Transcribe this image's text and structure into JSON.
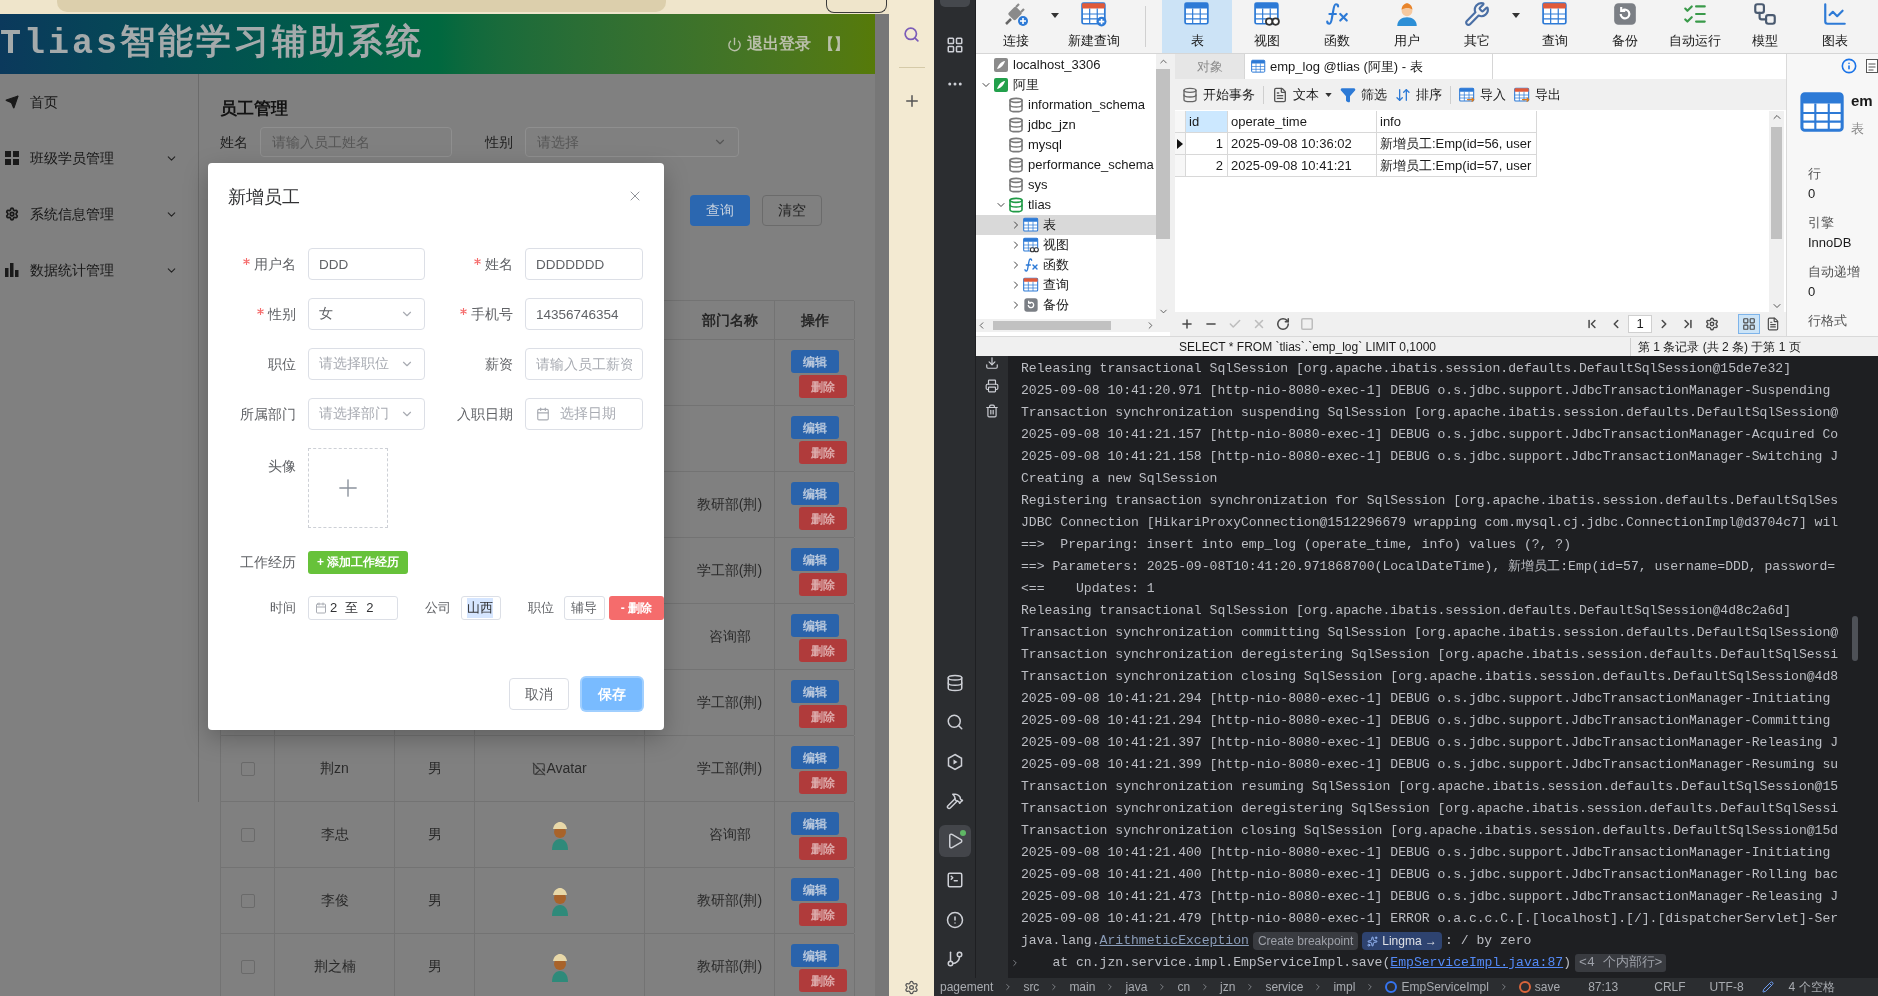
{
  "browser": {
    "header": {
      "title": "Tlias智能学习辅助系统",
      "logout": "退出登录",
      "header_button": "【】"
    },
    "sidebar": {
      "items": [
        {
          "label": "首页",
          "kind": "link"
        },
        {
          "label": "班级学员管理",
          "kind": "submenu"
        },
        {
          "label": "系统信息管理",
          "kind": "submenu"
        },
        {
          "label": "数据统计管理",
          "kind": "submenu"
        }
      ]
    },
    "page": {
      "title": "员工管理",
      "filters": [
        {
          "label": "姓名",
          "kind": "input",
          "placeholder": "请输入员工姓名"
        },
        {
          "label": "性别",
          "kind": "select",
          "placeholder": "请选择"
        }
      ],
      "buttons": [
        {
          "label": "查询",
          "kind": "primary"
        },
        {
          "label": "清空",
          "kind": "default"
        }
      ],
      "table": {
        "columns": [
          {
            "label": "部门名称"
          },
          {
            "label": "操作"
          }
        ],
        "rows": [
          {
            "actions": [
              {
                "label": "编辑",
                "kind": "edit"
              },
              {
                "label": "删除",
                "kind": "delete"
              }
            ]
          },
          {
            "actions": [
              {
                "label": "编辑",
                "kind": "edit"
              },
              {
                "label": "删除",
                "kind": "delete"
              }
            ]
          },
          {
            "department": "教研部(荆)",
            "actions": [
              {
                "label": "编辑",
                "kind": "edit"
              },
              {
                "label": "删除",
                "kind": "delete"
              }
            ]
          },
          {
            "department": "学工部(荆)",
            "actions": [
              {
                "label": "编辑",
                "kind": "edit"
              },
              {
                "label": "删除",
                "kind": "delete"
              }
            ]
          },
          {
            "department": "咨询部",
            "actions": [
              {
                "label": "编辑",
                "kind": "edit"
              },
              {
                "label": "删除",
                "kind": "delete"
              }
            ]
          },
          {
            "department": "学工部(荆)",
            "actions": [
              {
                "label": "编辑",
                "kind": "edit"
              },
              {
                "label": "删除",
                "kind": "delete"
              }
            ]
          },
          {
            "checked": false,
            "name": "荆zn",
            "gender": "男",
            "avatar": {
              "kind": "broken",
              "alt": "Avatar"
            },
            "department": "学工部(荆)",
            "actions": [
              {
                "label": "编辑",
                "kind": "edit"
              },
              {
                "label": "删除",
                "kind": "delete"
              }
            ]
          },
          {
            "checked": false,
            "name": "李忠",
            "gender": "男",
            "avatar": {
              "kind": "picture"
            },
            "department": "咨询部",
            "actions": [
              {
                "label": "编辑",
                "kind": "edit"
              },
              {
                "label": "删除",
                "kind": "delete"
              }
            ]
          },
          {
            "checked": false,
            "name": "李俊",
            "gender": "男",
            "avatar": {
              "kind": "picture"
            },
            "department": "教研部(荆)",
            "actions": [
              {
                "label": "编辑",
                "kind": "edit"
              },
              {
                "label": "删除",
                "kind": "delete"
              }
            ]
          },
          {
            "checked": false,
            "name": "荆之楠",
            "gender": "男",
            "avatar": {
              "kind": "picture"
            },
            "department": "教研部(荆)",
            "actions": [
              {
                "label": "编辑",
                "kind": "edit"
              },
              {
                "label": "删除",
                "kind": "delete"
              }
            ]
          }
        ]
      }
    }
  },
  "dialog": {
    "title": "新增员工",
    "fields": [
      {
        "label": "用户名",
        "required": true,
        "kind": "input",
        "value": "DDD"
      },
      {
        "label": "姓名",
        "required": true,
        "kind": "input",
        "value": "DDDDDDD"
      },
      {
        "label": "性别",
        "required": true,
        "kind": "select",
        "value": "女"
      },
      {
        "label": "手机号",
        "required": true,
        "kind": "input",
        "value": "14356746354"
      },
      {
        "label": "职位",
        "required": false,
        "kind": "select",
        "placeholder": "请选择职位"
      },
      {
        "label": "薪资",
        "required": false,
        "kind": "input",
        "placeholder": "请输入员工薪资"
      },
      {
        "label": "所属部门",
        "required": false,
        "kind": "select",
        "placeholder": "请选择部门"
      },
      {
        "label": "入职日期",
        "required": false,
        "kind": "date",
        "placeholder": "选择日期"
      }
    ],
    "avatar": {
      "label": "头像"
    },
    "work_history": {
      "label": "工作经历",
      "add_button": "+ 添加工作经历",
      "entries": [
        {
          "time_label": "时间",
          "start": "2",
          "separator": "至",
          "end": "2",
          "company_label": "公司",
          "company": "山西",
          "company_highlighted": true,
          "position_label": "职位",
          "position": "辅导",
          "delete_button": "- 删除"
        }
      ]
    },
    "buttons": [
      {
        "label": "取消",
        "kind": "default",
        "focused": false
      },
      {
        "label": "保存",
        "kind": "primary",
        "focused": true
      }
    ]
  },
  "navicat": {
    "toolbar": [
      {
        "label": "连接",
        "selected": false,
        "dropdown": true
      },
      {
        "label": "新建查询",
        "selected": false,
        "dropdown": false
      },
      {
        "label": "表",
        "selected": true,
        "dropdown": false
      },
      {
        "label": "视图",
        "selected": false,
        "dropdown": false
      },
      {
        "label": "函数",
        "selected": false,
        "dropdown": false
      },
      {
        "label": "用户",
        "selected": false,
        "dropdown": false
      },
      {
        "label": "其它",
        "selected": false,
        "dropdown": true
      },
      {
        "label": "查询",
        "selected": false,
        "dropdown": false
      },
      {
        "label": "备份",
        "selected": false,
        "dropdown": false
      },
      {
        "label": "自动运行",
        "selected": false,
        "dropdown": false
      },
      {
        "label": "模型",
        "selected": false,
        "dropdown": false
      },
      {
        "label": "图表",
        "selected": false,
        "dropdown": false
      }
    ],
    "tree": [
      {
        "label": "localhost_3306",
        "kind": "connection",
        "open": false,
        "selected": false
      },
      {
        "label": "阿里",
        "kind": "connection",
        "open": true,
        "expanded": true,
        "selected": false,
        "children": [
          {
            "label": "information_schema",
            "kind": "database",
            "open": false,
            "selected": false
          },
          {
            "label": "jdbc_jzn",
            "kind": "database",
            "open": false,
            "selected": false
          },
          {
            "label": "mysql",
            "kind": "database",
            "open": false,
            "selected": false
          },
          {
            "label": "performance_schema",
            "kind": "database",
            "open": false,
            "selected": false
          },
          {
            "label": "sys",
            "kind": "database",
            "open": false,
            "selected": false
          },
          {
            "label": "tlias",
            "kind": "database",
            "open": true,
            "expanded": true,
            "selected": false,
            "children": [
              {
                "label": "表",
                "kind": "tables",
                "expanded": false,
                "selected": true
              },
              {
                "label": "视图",
                "kind": "views",
                "expanded": false,
                "selected": false
              },
              {
                "label": "函数",
                "kind": "functions",
                "expanded": false,
                "selected": false
              },
              {
                "label": "查询",
                "kind": "queries",
                "expanded": false,
                "selected": false
              },
              {
                "label": "备份",
                "kind": "backups",
                "expanded": false,
                "selected": false
              }
            ]
          }
        ]
      }
    ],
    "tabs": [
      {
        "label": "对象",
        "kind": "objects",
        "selected": false
      },
      {
        "label": "emp_log @tlias (阿里) - 表",
        "kind": "table",
        "selected": true
      }
    ],
    "actions": [
      {
        "label": "开始事务",
        "dropdown": false
      },
      {
        "label": "文本",
        "dropdown": true
      },
      {
        "label": "筛选",
        "dropdown": false
      },
      {
        "label": "排序",
        "dropdown": false
      },
      {
        "label": "导入",
        "dropdown": false
      },
      {
        "label": "导出",
        "dropdown": false
      }
    ],
    "grid": {
      "columns": [
        {
          "label": "id",
          "selected": true
        },
        {
          "label": "operate_time",
          "selected": false
        },
        {
          "label": "info",
          "selected": false
        }
      ],
      "rows": [
        {
          "selected": true,
          "cells": [
            "1",
            "2025-09-08 10:36:02",
            "新增员工:Emp(id=56, user"
          ]
        },
        {
          "selected": false,
          "cells": [
            "2",
            "2025-09-08 10:41:21",
            "新增员工:Emp(id=57, user"
          ]
        }
      ]
    },
    "record_buttons": [
      {
        "disabled": false
      },
      {
        "disabled": false
      },
      {
        "disabled": true
      },
      {
        "disabled": true
      },
      {
        "disabled": false
      },
      {
        "disabled": true
      }
    ],
    "page_number": "1",
    "views": [
      {
        "selected": true
      },
      {
        "selected": false
      }
    ],
    "status": {
      "sql": "SELECT * FROM `tlias`.`emp_log` LIMIT 0,1000",
      "records": "第 1 条记录 (共 2 条) 于第 1 页"
    },
    "info": {
      "name": "em",
      "type": "表",
      "properties": [
        {
          "label": "行",
          "value": "0"
        },
        {
          "label": "引擎",
          "value": "InnoDB"
        },
        {
          "label": "自动递增",
          "value": "0"
        },
        {
          "label": "行格式"
        }
      ]
    }
  },
  "ide": {
    "tools": [
      {
        "selected": false
      },
      {
        "selected": false
      },
      {
        "selected": false
      },
      {
        "selected": false
      },
      {
        "selected": true,
        "running": true
      },
      {
        "selected": false
      },
      {
        "selected": false
      },
      {
        "selected": false
      }
    ],
    "console": {
      "lines": [
        {
          "kind": "text",
          "text": "Releasing transactional SqlSession [org.apache.ibatis.session.defaults.DefaultSqlSession@15de7e32]"
        },
        {
          "kind": "text",
          "text": "2025-09-08 10:41:20.971 [http-nio-8080-exec-1] DEBUG o.s.jdbc.support.JdbcTransactionManager-Suspending"
        },
        {
          "kind": "text",
          "text": "Transaction synchronization suspending SqlSession [org.apache.ibatis.session.defaults.DefaultSqlSession@"
        },
        {
          "kind": "text",
          "text": "2025-09-08 10:41:21.157 [http-nio-8080-exec-1] DEBUG o.s.jdbc.support.JdbcTransactionManager-Acquired Co"
        },
        {
          "kind": "text",
          "text": "2025-09-08 10:41:21.158 [http-nio-8080-exec-1] DEBUG o.s.jdbc.support.JdbcTransactionManager-Switching J"
        },
        {
          "kind": "text",
          "text": "Creating a new SqlSession"
        },
        {
          "kind": "text",
          "text": "Registering transaction synchronization for SqlSession [org.apache.ibatis.session.defaults.DefaultSqlSes"
        },
        {
          "kind": "text",
          "text": "JDBC Connection [HikariProxyConnection@1512296679 wrapping com.mysql.cj.jdbc.ConnectionImpl@d3704c7] wil"
        },
        {
          "kind": "text",
          "text": "==>  Preparing: insert into emp_log (operate_time, info) values (?, ?)"
        },
        {
          "kind": "text",
          "text": "==> Parameters: 2025-09-08T10:41:20.971868700(LocalDateTime), 新增员工:Emp(id=57, username=DDD, password="
        },
        {
          "kind": "text",
          "text": "<==    Updates: 1"
        },
        {
          "kind": "text",
          "text": "Releasing transactional SqlSession [org.apache.ibatis.session.defaults.DefaultSqlSession@4d8c2a6d]"
        },
        {
          "kind": "text",
          "text": "Transaction synchronization committing SqlSession [org.apache.ibatis.session.defaults.DefaultSqlSession@"
        },
        {
          "kind": "text",
          "text": "Transaction synchronization deregistering SqlSession [org.apache.ibatis.session.defaults.DefaultSqlSessi"
        },
        {
          "kind": "text",
          "text": "Transaction synchronization closing SqlSession [org.apache.ibatis.session.defaults.DefaultSqlSession@4d8"
        },
        {
          "kind": "text",
          "text": "2025-09-08 10:41:21.294 [http-nio-8080-exec-1] DEBUG o.s.jdbc.support.JdbcTransactionManager-Initiating"
        },
        {
          "kind": "text",
          "text": "2025-09-08 10:41:21.294 [http-nio-8080-exec-1] DEBUG o.s.jdbc.support.JdbcTransactionManager-Committing"
        },
        {
          "kind": "text",
          "text": "2025-09-08 10:41:21.397 [http-nio-8080-exec-1] DEBUG o.s.jdbc.support.JdbcTransactionManager-Releasing J"
        },
        {
          "kind": "text",
          "text": "2025-09-08 10:41:21.399 [http-nio-8080-exec-1] DEBUG o.s.jdbc.support.JdbcTransactionManager-Resuming su"
        },
        {
          "kind": "text",
          "text": "Transaction synchronization resuming SqlSession [org.apache.ibatis.session.defaults.DefaultSqlSession@15"
        },
        {
          "kind": "text",
          "text": "Transaction synchronization deregistering SqlSession [org.apache.ibatis.session.defaults.DefaultSqlSessi"
        },
        {
          "kind": "text",
          "text": "Transaction synchronization closing SqlSession [org.apache.ibatis.session.defaults.DefaultSqlSession@15d"
        },
        {
          "kind": "text",
          "text": "2025-09-08 10:41:21.400 [http-nio-8080-exec-1] DEBUG o.s.jdbc.support.JdbcTransactionManager-Initiating"
        },
        {
          "kind": "text",
          "text": "2025-09-08 10:41:21.400 [http-nio-8080-exec-1] DEBUG o.s.jdbc.support.JdbcTransactionManager-Rolling bac"
        },
        {
          "kind": "text",
          "text": "2025-09-08 10:41:21.473 [http-nio-8080-exec-1] DEBUG o.s.jdbc.support.JdbcTransactionManager-Releasing J"
        },
        {
          "kind": "text",
          "text": "2025-09-08 10:41:21.479 [http-nio-8080-exec-1] ERROR o.a.c.c.C.[.[localhost].[/].[dispatcherServlet]-Ser"
        },
        {
          "kind": "exception",
          "prefix": "java.lang.",
          "link": "ArithmeticException",
          "hints": [
            {
              "kind": "breakpoint",
              "label": "Create breakpoint"
            },
            {
              "kind": "assistant",
              "label": "Lingma →"
            }
          ],
          "suffix": ": / by zero"
        },
        {
          "kind": "trace",
          "prefix": "    at cn.jzn.service.impl.EmpServiceImpl.save(",
          "link": "EmpServiceImpl.java:87",
          "suffix": ")",
          "folded": "<4 个内部行>"
        }
      ]
    },
    "status_bar": {
      "path": [
        {
          "label": "pagement",
          "kind": "folder"
        },
        {
          "label": "src",
          "kind": "folder"
        },
        {
          "label": "main",
          "kind": "folder"
        },
        {
          "label": "java",
          "kind": "folder"
        },
        {
          "label": "cn",
          "kind": "folder"
        },
        {
          "label": "jzn",
          "kind": "folder"
        },
        {
          "label": "service",
          "kind": "folder"
        },
        {
          "label": "impl",
          "kind": "folder"
        },
        {
          "label": "EmpServiceImpl",
          "kind": "class"
        },
        {
          "label": "save",
          "kind": "method"
        }
      ],
      "caret": "87:13",
      "line_ending": "CRLF",
      "encoding": "UTF-8",
      "indent": "4 个空格"
    }
  }
}
